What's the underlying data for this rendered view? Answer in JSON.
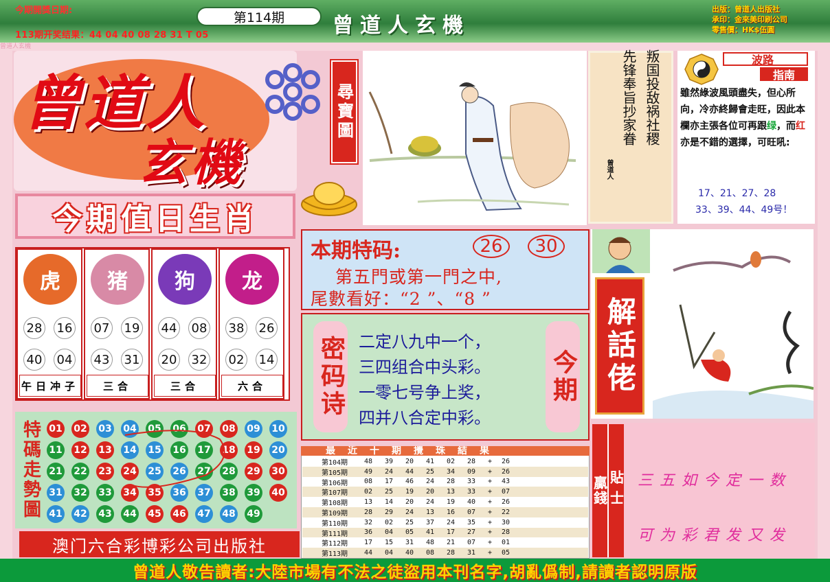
{
  "header": {
    "issue_date_label": "今期開獎日期:",
    "last_result": "113期开奖结果：44 04 40 08 28 31 T 05",
    "issue_badge": "第114期",
    "banner_title": "曾道人玄機",
    "pub_info": [
      "出版：曾道人出版社",
      "承印：金來美印刷公司",
      "零售價：HK$伍圓"
    ],
    "watermark": "曾道人玄機"
  },
  "logo": {
    "line1": "曾道人",
    "line2": "玄機",
    "treasure_tag": "尋寶圖"
  },
  "poem": {
    "col_right": "叛国投敌祸社稷",
    "col_left": "先锋奉旨抄家眷",
    "seal": "曾道人"
  },
  "guide": {
    "title_a": "波路",
    "title_b": "指南",
    "text_pre": "雖然綠波風頭盡失，但心所向，冷亦終歸會走旺，因此本欄亦主張各位可再跟",
    "green_word": "绿",
    "middle": "，而",
    "red_word": "红",
    "text_post": "亦是不錯的選擇，可旺吼:",
    "nums_line1": "17、21、27、28",
    "nums_line2": "33、39、44、49号！"
  },
  "zodiac": {
    "title": "今期值日生肖",
    "columns": [
      {
        "animal": "虎",
        "icon": "tiger-icon",
        "nums": [
          "28",
          "16",
          "40",
          "04"
        ],
        "label": "午日冲子"
      },
      {
        "animal": "猪",
        "icon": "pig-icon",
        "nums": [
          "07",
          "19",
          "43",
          "31"
        ],
        "label": "三合"
      },
      {
        "animal": "狗",
        "icon": "dog-icon",
        "nums": [
          "44",
          "08",
          "20",
          "32"
        ],
        "label": "三合"
      },
      {
        "animal": "龙",
        "icon": "dragon-icon",
        "nums": [
          "38",
          "26",
          "02",
          "14"
        ],
        "label": "六合"
      }
    ]
  },
  "special": {
    "title": "本期特码:",
    "num1": "26",
    "num2": "30",
    "line1": "第五門或第一門之中,",
    "line2": "尾數看好：“2 ”、“8 ”"
  },
  "code_poem": {
    "tag_left": "密码诗",
    "tag_right": "今期",
    "lines": [
      "二定八九中一个，",
      "三四组合中头彩。",
      "一零七号争上奖，",
      "四并八合定中彩。"
    ]
  },
  "trend": {
    "title": "特碼走勢圖",
    "colors": {
      "red": "#d8261e",
      "blue": "#2d8fd6",
      "green": "#1f9a3a"
    },
    "balls": [
      [
        "01",
        "r"
      ],
      [
        "02",
        "r"
      ],
      [
        "03",
        "b"
      ],
      [
        "04",
        "b"
      ],
      [
        "05",
        "g"
      ],
      [
        "06",
        "g"
      ],
      [
        "07",
        "r"
      ],
      [
        "08",
        "r"
      ],
      [
        "09",
        "b"
      ],
      [
        "10",
        "b"
      ],
      [
        "11",
        "g"
      ],
      [
        "12",
        "r"
      ],
      [
        "13",
        "r"
      ],
      [
        "14",
        "b"
      ],
      [
        "15",
        "b"
      ],
      [
        "16",
        "g"
      ],
      [
        "17",
        "g"
      ],
      [
        "18",
        "r"
      ],
      [
        "19",
        "r"
      ],
      [
        "20",
        "b"
      ],
      [
        "21",
        "g"
      ],
      [
        "22",
        "g"
      ],
      [
        "23",
        "r"
      ],
      [
        "24",
        "r"
      ],
      [
        "25",
        "b"
      ],
      [
        "26",
        "b"
      ],
      [
        "27",
        "g"
      ],
      [
        "28",
        "g"
      ],
      [
        "29",
        "r"
      ],
      [
        "30",
        "r"
      ],
      [
        "31",
        "b"
      ],
      [
        "32",
        "g"
      ],
      [
        "33",
        "g"
      ],
      [
        "34",
        "r"
      ],
      [
        "35",
        "r"
      ],
      [
        "36",
        "b"
      ],
      [
        "37",
        "b"
      ],
      [
        "38",
        "g"
      ],
      [
        "39",
        "g"
      ],
      [
        "40",
        "r"
      ],
      [
        "41",
        "b"
      ],
      [
        "42",
        "b"
      ],
      [
        "43",
        "g"
      ],
      [
        "44",
        "g"
      ],
      [
        "45",
        "r"
      ],
      [
        "46",
        "r"
      ],
      [
        "47",
        "b"
      ],
      [
        "48",
        "b"
      ],
      [
        "49",
        "g"
      ]
    ]
  },
  "publisher": "澳门六合彩博彩公司出版社",
  "results": {
    "header": "最近十期攪珠結果",
    "rows": [
      [
        "第104期",
        "48",
        "39",
        "20",
        "41",
        "02",
        "28",
        "+",
        "26"
      ],
      [
        "第105期",
        "49",
        "24",
        "44",
        "25",
        "34",
        "09",
        "+",
        "26"
      ],
      [
        "第106期",
        "08",
        "17",
        "46",
        "24",
        "28",
        "33",
        "+",
        "43"
      ],
      [
        "第107期",
        "02",
        "25",
        "19",
        "20",
        "13",
        "33",
        "+",
        "07"
      ],
      [
        "第108期",
        "13",
        "14",
        "20",
        "24",
        "19",
        "40",
        "+",
        "26"
      ],
      [
        "第109期",
        "28",
        "29",
        "24",
        "13",
        "16",
        "07",
        "+",
        "22"
      ],
      [
        "第110期",
        "32",
        "02",
        "25",
        "37",
        "24",
        "35",
        "+",
        "30"
      ],
      [
        "第111期",
        "36",
        "04",
        "05",
        "41",
        "17",
        "27",
        "+",
        "28"
      ],
      [
        "第112期",
        "17",
        "15",
        "31",
        "48",
        "21",
        "07",
        "+",
        "01"
      ],
      [
        "第113期",
        "44",
        "04",
        "40",
        "08",
        "28",
        "31",
        "+",
        "05"
      ]
    ]
  },
  "explain_tag": "解話佬",
  "tips": {
    "tag1": "贏錢",
    "tag2": "貼士",
    "line1": "三五如今定一数",
    "line2": "可为彩君发又发"
  },
  "footer": "曾道人敬告讀者:大陸市場有不法之徒盜用本刊名字,胡亂僞制,請讀者認明原版"
}
